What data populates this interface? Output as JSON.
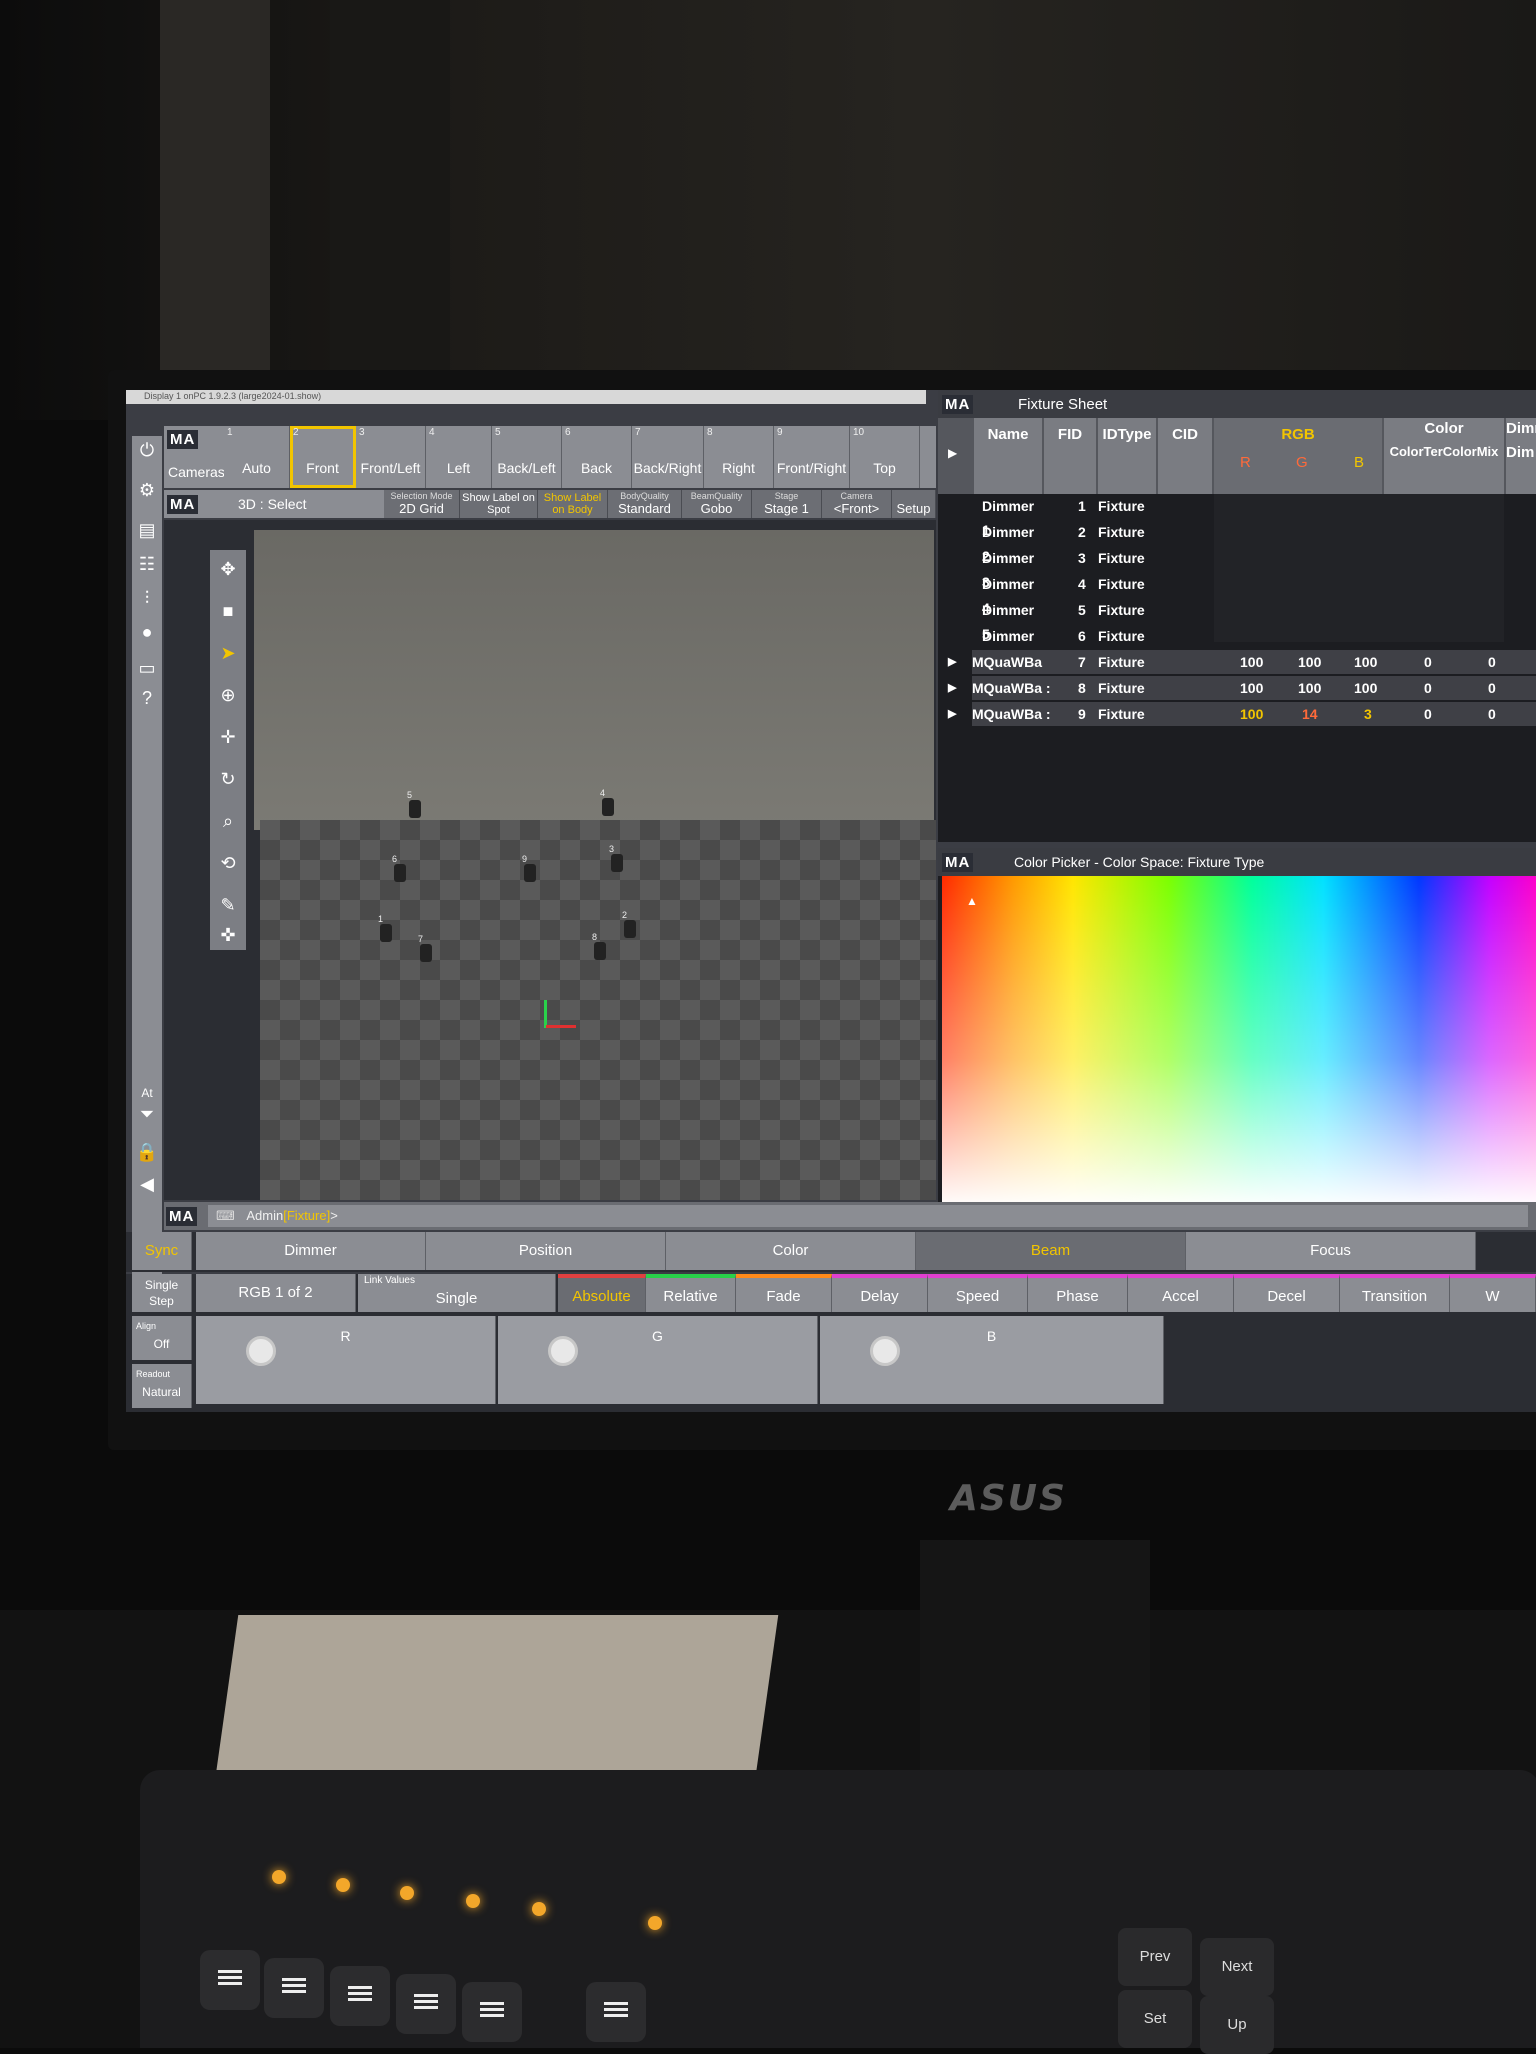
{
  "title_bar": "Display 1 onPC 1.9.2.3 (large2024-01.show)",
  "ma_logo": "MA",
  "views_bar": {
    "cameras_label": "Cameras",
    "buttons": [
      {
        "num": "1",
        "label": "Auto"
      },
      {
        "num": "2",
        "label": "Front"
      },
      {
        "num": "3",
        "label": "Front/Left"
      },
      {
        "num": "4",
        "label": "Left"
      },
      {
        "num": "5",
        "label": "Back/Left"
      },
      {
        "num": "6",
        "label": "Back"
      },
      {
        "num": "7",
        "label": "Back/Right"
      },
      {
        "num": "8",
        "label": "Right"
      },
      {
        "num": "9",
        "label": "Front/Right"
      },
      {
        "num": "10",
        "label": "Top"
      }
    ]
  },
  "viewer_toolbar": {
    "title": "3D : Select",
    "options": [
      {
        "title": "Selection Mode",
        "value": "2D Grid"
      },
      {
        "title": "",
        "value": "Show Label on Spot"
      },
      {
        "title": "",
        "value": "Show Label on Body"
      },
      {
        "title": "BodyQuality",
        "value": "Standard"
      },
      {
        "title": "BeamQuality",
        "value": "Gobo"
      },
      {
        "title": "Stage",
        "value": "Stage 1"
      },
      {
        "title": "Camera",
        "value": "<Front>"
      },
      {
        "title": "",
        "value": "Setup"
      }
    ]
  },
  "viewer_fixtures": [
    "5",
    "4",
    "6",
    "9",
    "3",
    "1",
    "2",
    "7",
    "8"
  ],
  "fixture_sheet": {
    "title": "Fixture Sheet",
    "headers": {
      "name": "Name",
      "fid": "FID",
      "idtype": "IDType",
      "cid": "CID",
      "rgb": "RGB",
      "r": "R",
      "g": "G",
      "b": "B",
      "color": "Color",
      "colormix": "ColorTerColorMix",
      "dimmer": "Dimme",
      "dim": "Dim"
    },
    "rows": [
      {
        "name": "Dimmer 1",
        "fid": "1",
        "type": "Fixture",
        "r": "",
        "g": "",
        "b": "",
        "c1": "",
        "c2": ""
      },
      {
        "name": "Dimmer 2",
        "fid": "2",
        "type": "Fixture",
        "r": "",
        "g": "",
        "b": "",
        "c1": "",
        "c2": ""
      },
      {
        "name": "Dimmer 3",
        "fid": "3",
        "type": "Fixture",
        "r": "",
        "g": "",
        "b": "",
        "c1": "",
        "c2": ""
      },
      {
        "name": "Dimmer 4",
        "fid": "4",
        "type": "Fixture",
        "r": "",
        "g": "",
        "b": "",
        "c1": "",
        "c2": ""
      },
      {
        "name": "Dimmer 5",
        "fid": "5",
        "type": "Fixture",
        "r": "",
        "g": "",
        "b": "",
        "c1": "",
        "c2": ""
      },
      {
        "name": "Dimmer 6",
        "fid": "6",
        "type": "Fixture",
        "r": "",
        "g": "",
        "b": "",
        "c1": "",
        "c2": ""
      },
      {
        "name": "MQuaWBa",
        "fid": "7",
        "type": "Fixture",
        "r": "100",
        "g": "100",
        "b": "100",
        "c1": "0",
        "c2": "0"
      },
      {
        "name": "MQuaWBa :",
        "fid": "8",
        "type": "Fixture",
        "r": "100",
        "g": "100",
        "b": "100",
        "c1": "0",
        "c2": "0"
      },
      {
        "name": "MQuaWBa :",
        "fid": "9",
        "type": "Fixture",
        "r": "100",
        "g": "14",
        "b": "3",
        "c1": "0",
        "c2": "0"
      }
    ]
  },
  "color_picker": {
    "title": "Color Picker - Color Space: Fixture Type"
  },
  "command_line": {
    "prefix": "Admin",
    "object": "[Fixture]",
    "suffix": ">"
  },
  "side_labels": {
    "at": "At"
  },
  "presets_bar": {
    "sync": "Sync",
    "tabs": [
      "Dimmer",
      "Position",
      "Color",
      "Beam",
      "Focus"
    ]
  },
  "encoder_bar": {
    "single_step": "Single Step",
    "rgb_page": "RGB 1 of 2",
    "link_values_title": "Link Values",
    "link_values": "Single",
    "modes": [
      "Absolute",
      "Relative",
      "Fade",
      "Delay",
      "Speed",
      "Phase",
      "Accel",
      "Decel",
      "Transition",
      "W"
    ],
    "align_title": "Align",
    "align": "Off",
    "readout_title": "Readout",
    "readout": "Natural",
    "encoders": [
      "R",
      "G",
      "B"
    ]
  },
  "monitor_brand": "ASUS",
  "console_keys": [
    "Prev",
    "Next",
    "Set",
    "Up"
  ],
  "colors": {
    "accent_yellow": "#f2c500",
    "panel_gray": "#8b8d93",
    "dark_bg": "#2b2d33"
  }
}
